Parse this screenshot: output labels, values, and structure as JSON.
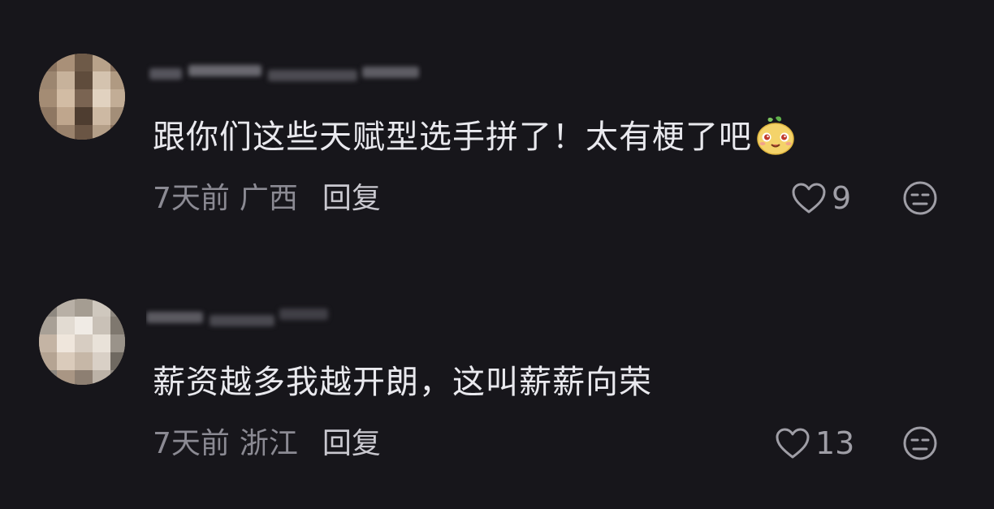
{
  "comments": [
    {
      "text": "跟你们这些天赋型选手拼了！太有梗了吧",
      "time": "7天前",
      "location": "广西",
      "reply_label": "回复",
      "like_count": "9",
      "emoji_icon": "cute-face-sticker-icon"
    },
    {
      "text": "薪资越多我越开朗，这叫薪薪向荣",
      "time": "7天前",
      "location": "浙江",
      "reply_label": "回复",
      "like_count": "13"
    }
  ],
  "colors": {
    "background": "#17161b",
    "text_primary": "#e9e9ee",
    "text_secondary": "#8b8a93",
    "icon": "#9f9ea6"
  }
}
